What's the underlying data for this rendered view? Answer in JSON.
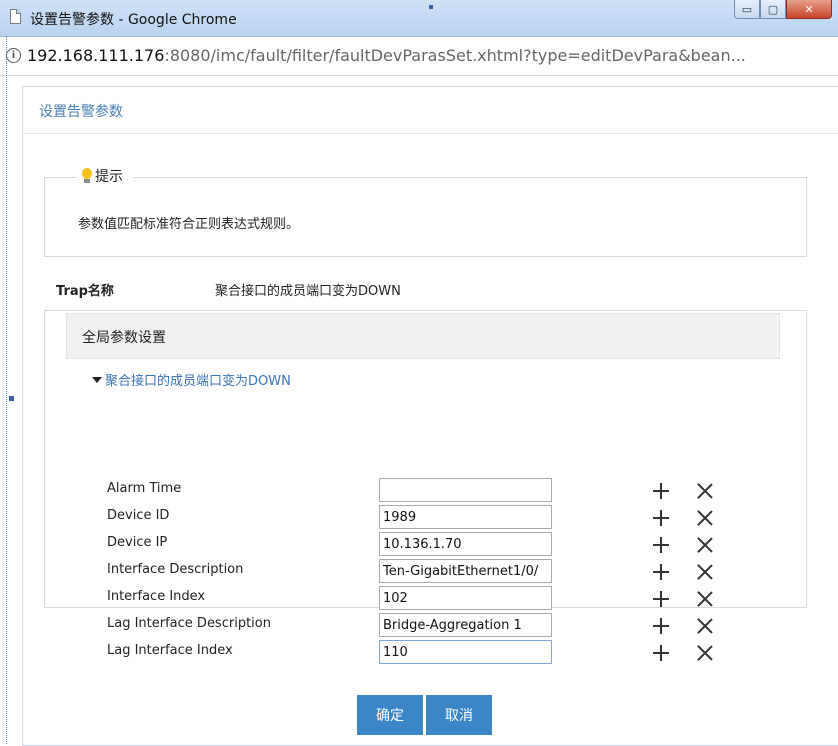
{
  "window": {
    "title": "设置告警参数 - Google Chrome",
    "controls": {
      "minimize": "▭",
      "maximize": "▢",
      "close": "✕"
    }
  },
  "address": {
    "host": "192.168.111.176",
    "rest": ":8080/imc/fault/filter/faultDevParasSet.xhtml?type=editDevPara&bean..."
  },
  "dialog": {
    "title": "设置告警参数",
    "tip": {
      "legend": "提示",
      "text": "参数值匹配标准符合正则表达式规则。"
    },
    "trap": {
      "label": "Trap名称",
      "value": "聚合接口的成员端口变为DOWN"
    },
    "global_panel": {
      "title": "全局参数设置",
      "node_label": "聚合接口的成员端口变为DOWN",
      "params": [
        {
          "label": "Alarm Time",
          "value": ""
        },
        {
          "label": "Device ID",
          "value": "1989"
        },
        {
          "label": "Device IP",
          "value": "10.136.1.70"
        },
        {
          "label": "Interface Description",
          "value": "Ten-GigabitEthernet1/0/"
        },
        {
          "label": "Interface Index",
          "value": "102"
        },
        {
          "label": "Lag Interface Description",
          "value": "Bridge-Aggregation 1"
        },
        {
          "label": "Lag Interface Index",
          "value": "110"
        }
      ]
    },
    "buttons": {
      "ok": "确定",
      "cancel": "取消"
    }
  },
  "colors": {
    "accent": "#3c86c8",
    "title_link": "#4a7fb5",
    "tree_link": "#3a72b6",
    "bulb": "#f6c21b"
  },
  "icons": [
    "page-icon",
    "info-icon",
    "bulb-icon",
    "caret-down-icon",
    "plus-icon",
    "close-icon"
  ]
}
